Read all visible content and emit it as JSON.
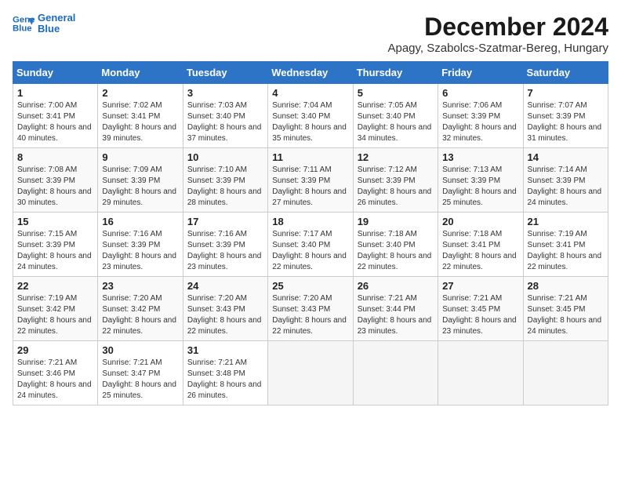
{
  "logo": {
    "line1": "General",
    "line2": "Blue"
  },
  "title": "December 2024",
  "location": "Apagy, Szabolcs-Szatmar-Bereg, Hungary",
  "days_header": [
    "Sunday",
    "Monday",
    "Tuesday",
    "Wednesday",
    "Thursday",
    "Friday",
    "Saturday"
  ],
  "weeks": [
    [
      {
        "day": "1",
        "info": "Sunrise: 7:00 AM\nSunset: 3:41 PM\nDaylight: 8 hours\nand 40 minutes."
      },
      {
        "day": "2",
        "info": "Sunrise: 7:02 AM\nSunset: 3:41 PM\nDaylight: 8 hours\nand 39 minutes."
      },
      {
        "day": "3",
        "info": "Sunrise: 7:03 AM\nSunset: 3:40 PM\nDaylight: 8 hours\nand 37 minutes."
      },
      {
        "day": "4",
        "info": "Sunrise: 7:04 AM\nSunset: 3:40 PM\nDaylight: 8 hours\nand 35 minutes."
      },
      {
        "day": "5",
        "info": "Sunrise: 7:05 AM\nSunset: 3:40 PM\nDaylight: 8 hours\nand 34 minutes."
      },
      {
        "day": "6",
        "info": "Sunrise: 7:06 AM\nSunset: 3:39 PM\nDaylight: 8 hours\nand 32 minutes."
      },
      {
        "day": "7",
        "info": "Sunrise: 7:07 AM\nSunset: 3:39 PM\nDaylight: 8 hours\nand 31 minutes."
      }
    ],
    [
      {
        "day": "8",
        "info": "Sunrise: 7:08 AM\nSunset: 3:39 PM\nDaylight: 8 hours\nand 30 minutes."
      },
      {
        "day": "9",
        "info": "Sunrise: 7:09 AM\nSunset: 3:39 PM\nDaylight: 8 hours\nand 29 minutes."
      },
      {
        "day": "10",
        "info": "Sunrise: 7:10 AM\nSunset: 3:39 PM\nDaylight: 8 hours\nand 28 minutes."
      },
      {
        "day": "11",
        "info": "Sunrise: 7:11 AM\nSunset: 3:39 PM\nDaylight: 8 hours\nand 27 minutes."
      },
      {
        "day": "12",
        "info": "Sunrise: 7:12 AM\nSunset: 3:39 PM\nDaylight: 8 hours\nand 26 minutes."
      },
      {
        "day": "13",
        "info": "Sunrise: 7:13 AM\nSunset: 3:39 PM\nDaylight: 8 hours\nand 25 minutes."
      },
      {
        "day": "14",
        "info": "Sunrise: 7:14 AM\nSunset: 3:39 PM\nDaylight: 8 hours\nand 24 minutes."
      }
    ],
    [
      {
        "day": "15",
        "info": "Sunrise: 7:15 AM\nSunset: 3:39 PM\nDaylight: 8 hours\nand 24 minutes."
      },
      {
        "day": "16",
        "info": "Sunrise: 7:16 AM\nSunset: 3:39 PM\nDaylight: 8 hours\nand 23 minutes."
      },
      {
        "day": "17",
        "info": "Sunrise: 7:16 AM\nSunset: 3:39 PM\nDaylight: 8 hours\nand 23 minutes."
      },
      {
        "day": "18",
        "info": "Sunrise: 7:17 AM\nSunset: 3:40 PM\nDaylight: 8 hours\nand 22 minutes."
      },
      {
        "day": "19",
        "info": "Sunrise: 7:18 AM\nSunset: 3:40 PM\nDaylight: 8 hours\nand 22 minutes."
      },
      {
        "day": "20",
        "info": "Sunrise: 7:18 AM\nSunset: 3:41 PM\nDaylight: 8 hours\nand 22 minutes."
      },
      {
        "day": "21",
        "info": "Sunrise: 7:19 AM\nSunset: 3:41 PM\nDaylight: 8 hours\nand 22 minutes."
      }
    ],
    [
      {
        "day": "22",
        "info": "Sunrise: 7:19 AM\nSunset: 3:42 PM\nDaylight: 8 hours\nand 22 minutes."
      },
      {
        "day": "23",
        "info": "Sunrise: 7:20 AM\nSunset: 3:42 PM\nDaylight: 8 hours\nand 22 minutes."
      },
      {
        "day": "24",
        "info": "Sunrise: 7:20 AM\nSunset: 3:43 PM\nDaylight: 8 hours\nand 22 minutes."
      },
      {
        "day": "25",
        "info": "Sunrise: 7:20 AM\nSunset: 3:43 PM\nDaylight: 8 hours\nand 22 minutes."
      },
      {
        "day": "26",
        "info": "Sunrise: 7:21 AM\nSunset: 3:44 PM\nDaylight: 8 hours\nand 23 minutes."
      },
      {
        "day": "27",
        "info": "Sunrise: 7:21 AM\nSunset: 3:45 PM\nDaylight: 8 hours\nand 23 minutes."
      },
      {
        "day": "28",
        "info": "Sunrise: 7:21 AM\nSunset: 3:45 PM\nDaylight: 8 hours\nand 24 minutes."
      }
    ],
    [
      {
        "day": "29",
        "info": "Sunrise: 7:21 AM\nSunset: 3:46 PM\nDaylight: 8 hours\nand 24 minutes."
      },
      {
        "day": "30",
        "info": "Sunrise: 7:21 AM\nSunset: 3:47 PM\nDaylight: 8 hours\nand 25 minutes."
      },
      {
        "day": "31",
        "info": "Sunrise: 7:21 AM\nSunset: 3:48 PM\nDaylight: 8 hours\nand 26 minutes."
      },
      null,
      null,
      null,
      null
    ]
  ]
}
